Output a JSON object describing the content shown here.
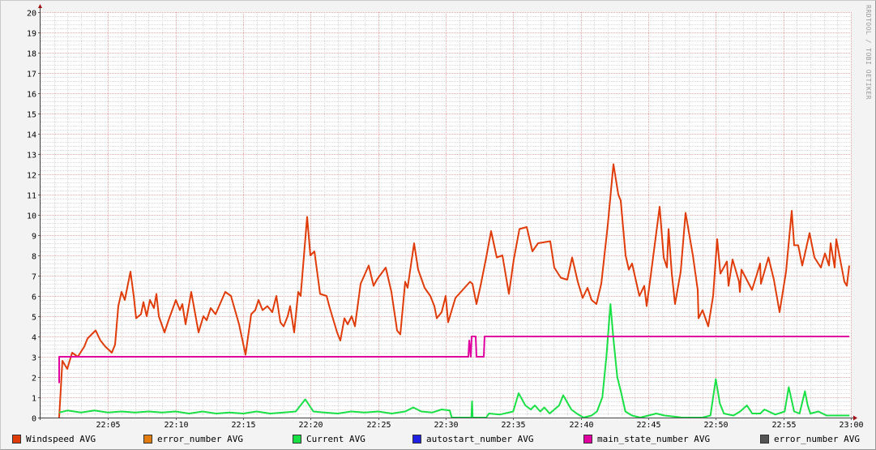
{
  "chart_data": {
    "type": "line",
    "title": "",
    "xlabel": "",
    "ylabel": "",
    "ylim": [
      0,
      20
    ],
    "xlim_minutes_after_22_00": [
      0,
      60
    ],
    "grid": true,
    "legend_position": "bottom",
    "y_ticks": [
      "0",
      "1",
      "2",
      "3",
      "4",
      "5",
      "6",
      "7",
      "8",
      "9",
      "10",
      "11",
      "12",
      "13",
      "14",
      "15",
      "16",
      "17",
      "18",
      "19",
      "20"
    ],
    "x_ticks": [
      {
        "t": 5,
        "label": "22:05"
      },
      {
        "t": 10,
        "label": "22:10"
      },
      {
        "t": 15,
        "label": "22:15"
      },
      {
        "t": 20,
        "label": "22:20"
      },
      {
        "t": 25,
        "label": "22:25"
      },
      {
        "t": 30,
        "label": "22:30"
      },
      {
        "t": 35,
        "label": "22:35"
      },
      {
        "t": 40,
        "label": "22:40"
      },
      {
        "t": 45,
        "label": "22:45"
      },
      {
        "t": 50,
        "label": "22:50"
      },
      {
        "t": 55,
        "label": "22:55"
      },
      {
        "t": 60,
        "label": "23:00"
      }
    ],
    "series": [
      {
        "name": "Windspeed AVG",
        "color": "#e03c0a",
        "points": [
          [
            1.38,
            0
          ],
          [
            1.62,
            2.8
          ],
          [
            1.98,
            2.4
          ],
          [
            2.34,
            3.2
          ],
          [
            2.76,
            3.0
          ],
          [
            3.24,
            3.5
          ],
          [
            3.48,
            3.9
          ],
          [
            4.08,
            4.3
          ],
          [
            4.44,
            3.8
          ],
          [
            4.8,
            3.5
          ],
          [
            5.28,
            3.2
          ],
          [
            5.52,
            3.6
          ],
          [
            5.76,
            5.5
          ],
          [
            6.0,
            6.2
          ],
          [
            6.24,
            5.8
          ],
          [
            6.66,
            7.2
          ],
          [
            6.9,
            6.0
          ],
          [
            7.08,
            4.9
          ],
          [
            7.44,
            5.1
          ],
          [
            7.62,
            5.7
          ],
          [
            7.86,
            5.0
          ],
          [
            8.1,
            5.8
          ],
          [
            8.4,
            5.4
          ],
          [
            8.58,
            6.1
          ],
          [
            8.76,
            5.0
          ],
          [
            9.18,
            4.2
          ],
          [
            9.48,
            4.8
          ],
          [
            10.02,
            5.8
          ],
          [
            10.32,
            5.3
          ],
          [
            10.5,
            5.6
          ],
          [
            10.74,
            4.6
          ],
          [
            11.16,
            6.2
          ],
          [
            11.7,
            4.2
          ],
          [
            12.06,
            5.0
          ],
          [
            12.3,
            4.8
          ],
          [
            12.6,
            5.4
          ],
          [
            12.96,
            5.1
          ],
          [
            13.68,
            6.2
          ],
          [
            14.1,
            6.0
          ],
          [
            14.7,
            4.6
          ],
          [
            15.18,
            3.1
          ],
          [
            15.6,
            5.1
          ],
          [
            15.9,
            5.3
          ],
          [
            16.14,
            5.8
          ],
          [
            16.44,
            5.3
          ],
          [
            16.8,
            5.5
          ],
          [
            17.16,
            5.2
          ],
          [
            17.46,
            6.0
          ],
          [
            17.76,
            4.7
          ],
          [
            18.0,
            4.5
          ],
          [
            18.3,
            5.0
          ],
          [
            18.48,
            5.5
          ],
          [
            18.78,
            4.2
          ],
          [
            19.08,
            6.2
          ],
          [
            19.26,
            6.0
          ],
          [
            19.74,
            9.9
          ],
          [
            19.98,
            8.0
          ],
          [
            20.28,
            8.2
          ],
          [
            20.7,
            6.1
          ],
          [
            21.18,
            6.0
          ],
          [
            21.42,
            5.4
          ],
          [
            21.96,
            4.2
          ],
          [
            22.2,
            3.8
          ],
          [
            22.5,
            4.9
          ],
          [
            22.74,
            4.6
          ],
          [
            23.04,
            5.0
          ],
          [
            23.28,
            4.5
          ],
          [
            23.7,
            6.6
          ],
          [
            24.3,
            7.5
          ],
          [
            24.66,
            6.5
          ],
          [
            24.9,
            6.8
          ],
          [
            25.56,
            7.4
          ],
          [
            25.98,
            6.2
          ],
          [
            26.4,
            4.3
          ],
          [
            26.64,
            4.1
          ],
          [
            27.0,
            6.7
          ],
          [
            27.18,
            6.4
          ],
          [
            27.66,
            8.6
          ],
          [
            27.96,
            7.3
          ],
          [
            28.44,
            6.4
          ],
          [
            28.86,
            6.0
          ],
          [
            29.16,
            5.5
          ],
          [
            29.34,
            4.9
          ],
          [
            29.7,
            5.2
          ],
          [
            30.0,
            6.0
          ],
          [
            30.18,
            4.7
          ],
          [
            30.72,
            5.9
          ],
          [
            31.8,
            6.7
          ],
          [
            31.98,
            6.6
          ],
          [
            32.28,
            5.6
          ],
          [
            32.58,
            6.5
          ],
          [
            33.0,
            7.9
          ],
          [
            33.36,
            9.2
          ],
          [
            33.78,
            7.9
          ],
          [
            34.2,
            8.0
          ],
          [
            34.68,
            6.1
          ],
          [
            35.04,
            7.8
          ],
          [
            35.46,
            9.3
          ],
          [
            36.0,
            9.4
          ],
          [
            36.42,
            8.2
          ],
          [
            36.84,
            8.6
          ],
          [
            37.74,
            8.7
          ],
          [
            38.04,
            7.4
          ],
          [
            38.52,
            6.9
          ],
          [
            39.0,
            6.8
          ],
          [
            39.36,
            7.9
          ],
          [
            39.78,
            6.7
          ],
          [
            40.14,
            5.9
          ],
          [
            40.5,
            6.4
          ],
          [
            40.8,
            5.8
          ],
          [
            41.16,
            5.6
          ],
          [
            41.52,
            6.6
          ],
          [
            42.0,
            9.5
          ],
          [
            42.42,
            12.5
          ],
          [
            42.78,
            11.0
          ],
          [
            42.96,
            10.7
          ],
          [
            43.32,
            8.0
          ],
          [
            43.56,
            7.3
          ],
          [
            43.8,
            7.6
          ],
          [
            44.34,
            6.0
          ],
          [
            44.7,
            6.5
          ],
          [
            44.88,
            5.5
          ],
          [
            45.18,
            7.0
          ],
          [
            45.84,
            10.4
          ],
          [
            46.14,
            7.9
          ],
          [
            46.38,
            7.4
          ],
          [
            46.5,
            9.3
          ],
          [
            46.74,
            7.1
          ],
          [
            46.98,
            5.6
          ],
          [
            47.4,
            7.2
          ],
          [
            47.76,
            10.1
          ],
          [
            48.3,
            8.0
          ],
          [
            48.66,
            6.3
          ],
          [
            48.72,
            4.9
          ],
          [
            49.02,
            5.3
          ],
          [
            49.44,
            4.5
          ],
          [
            49.8,
            6.0
          ],
          [
            50.1,
            8.8
          ],
          [
            50.34,
            7.1
          ],
          [
            50.82,
            7.7
          ],
          [
            50.94,
            6.5
          ],
          [
            51.24,
            7.8
          ],
          [
            51.72,
            6.7
          ],
          [
            51.78,
            6.2
          ],
          [
            51.9,
            7.3
          ],
          [
            52.68,
            6.3
          ],
          [
            53.1,
            7.2
          ],
          [
            53.28,
            7.6
          ],
          [
            53.34,
            6.6
          ],
          [
            53.9,
            7.9
          ],
          [
            54.3,
            6.8
          ],
          [
            54.72,
            5.2
          ],
          [
            55.2,
            7.2
          ],
          [
            55.62,
            10.2
          ],
          [
            55.8,
            8.5
          ],
          [
            56.1,
            8.5
          ],
          [
            56.4,
            7.5
          ],
          [
            56.94,
            9.1
          ],
          [
            57.3,
            7.9
          ],
          [
            57.78,
            7.4
          ],
          [
            58.08,
            8.1
          ],
          [
            58.38,
            7.5
          ],
          [
            58.5,
            8.6
          ],
          [
            58.8,
            7.4
          ],
          [
            58.92,
            8.8
          ],
          [
            59.52,
            6.7
          ],
          [
            59.7,
            6.5
          ],
          [
            59.88,
            7.5
          ]
        ]
      },
      {
        "name": "error_number AVG",
        "color": "#e07c10",
        "points": []
      },
      {
        "name": "Current AVG",
        "color": "#19e044",
        "points": [
          [
            1.38,
            0.25
          ],
          [
            2.0,
            0.35
          ],
          [
            3.0,
            0.25
          ],
          [
            4.0,
            0.35
          ],
          [
            5.0,
            0.25
          ],
          [
            6.0,
            0.3
          ],
          [
            7.0,
            0.25
          ],
          [
            8.0,
            0.3
          ],
          [
            9.0,
            0.25
          ],
          [
            10.0,
            0.3
          ],
          [
            11.0,
            0.2
          ],
          [
            12.0,
            0.3
          ],
          [
            13.0,
            0.2
          ],
          [
            14.0,
            0.25
          ],
          [
            15.0,
            0.2
          ],
          [
            16.0,
            0.3
          ],
          [
            17.0,
            0.2
          ],
          [
            18.0,
            0.25
          ],
          [
            18.9,
            0.3
          ],
          [
            19.6,
            0.9
          ],
          [
            20.2,
            0.3
          ],
          [
            21.0,
            0.25
          ],
          [
            22.0,
            0.2
          ],
          [
            23.0,
            0.3
          ],
          [
            24.0,
            0.25
          ],
          [
            25.0,
            0.3
          ],
          [
            26.0,
            0.2
          ],
          [
            27.0,
            0.3
          ],
          [
            27.6,
            0.5
          ],
          [
            28.2,
            0.3
          ],
          [
            29.0,
            0.25
          ],
          [
            29.7,
            0.4
          ],
          [
            30.3,
            0.35
          ],
          [
            30.45,
            0
          ],
          [
            31.9,
            0
          ],
          [
            31.95,
            0.8
          ],
          [
            32.0,
            0
          ],
          [
            33.0,
            0
          ],
          [
            33.2,
            0.2
          ],
          [
            34.0,
            0.15
          ],
          [
            35.0,
            0.3
          ],
          [
            35.4,
            1.2
          ],
          [
            35.9,
            0.6
          ],
          [
            36.3,
            0.4
          ],
          [
            36.6,
            0.6
          ],
          [
            37.0,
            0.3
          ],
          [
            37.3,
            0.5
          ],
          [
            37.7,
            0.2
          ],
          [
            38.4,
            0.6
          ],
          [
            38.7,
            1.1
          ],
          [
            39.3,
            0.4
          ],
          [
            39.7,
            0.2
          ],
          [
            40.2,
            0
          ],
          [
            40.8,
            0.1
          ],
          [
            41.2,
            0.3
          ],
          [
            41.6,
            1.0
          ],
          [
            41.9,
            3.0
          ],
          [
            42.2,
            5.6
          ],
          [
            42.4,
            4.0
          ],
          [
            42.7,
            2.0
          ],
          [
            43.0,
            1.2
          ],
          [
            43.3,
            0.3
          ],
          [
            43.8,
            0.1
          ],
          [
            44.4,
            0
          ],
          [
            45.0,
            0.1
          ],
          [
            45.6,
            0.2
          ],
          [
            46.2,
            0.1
          ],
          [
            46.9,
            0.05
          ],
          [
            47.5,
            0
          ],
          [
            49.0,
            0
          ],
          [
            49.6,
            0.1
          ],
          [
            50.0,
            1.9
          ],
          [
            50.3,
            0.7
          ],
          [
            50.6,
            0.2
          ],
          [
            51.3,
            0.1
          ],
          [
            51.8,
            0.3
          ],
          [
            52.3,
            0.6
          ],
          [
            52.7,
            0.2
          ],
          [
            53.3,
            0.2
          ],
          [
            53.6,
            0.4
          ],
          [
            54.4,
            0.15
          ],
          [
            55.1,
            0.3
          ],
          [
            55.4,
            1.5
          ],
          [
            55.8,
            0.3
          ],
          [
            56.2,
            0.2
          ],
          [
            56.6,
            1.3
          ],
          [
            56.8,
            0.6
          ],
          [
            57.0,
            0.2
          ],
          [
            57.6,
            0.3
          ],
          [
            58.2,
            0.1
          ],
          [
            59.0,
            0.1
          ],
          [
            59.9,
            0.1
          ]
        ]
      },
      {
        "name": "autostart_number AVG",
        "color": "#2020e0",
        "points": []
      },
      {
        "name": "main_state_number AVG",
        "color": "#e000a0",
        "points": [
          [
            1.38,
            1.7
          ],
          [
            1.38,
            3
          ],
          [
            31.68,
            3
          ],
          [
            31.74,
            3.8
          ],
          [
            31.86,
            3
          ],
          [
            31.92,
            4
          ],
          [
            32.22,
            4
          ],
          [
            32.28,
            3
          ],
          [
            32.82,
            3
          ],
          [
            32.88,
            4
          ],
          [
            59.88,
            4
          ]
        ]
      },
      {
        "name": "error_number AVG",
        "color": "#555555",
        "points": []
      }
    ],
    "credit": "RRDTOOL / TOBI OETIKER"
  }
}
